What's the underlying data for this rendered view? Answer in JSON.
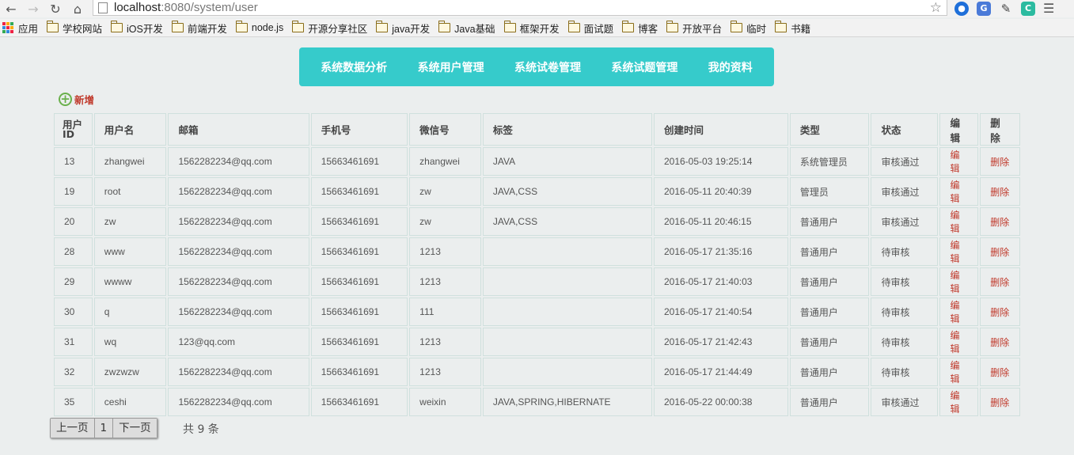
{
  "browser": {
    "url_host": "localhost",
    "url_path": ":8080/system/user",
    "bookmarks": [
      {
        "label": "应用",
        "icon": "apps-icon"
      },
      {
        "label": "学校网站",
        "icon": "folder-icon"
      },
      {
        "label": "iOS开发",
        "icon": "folder-icon"
      },
      {
        "label": "前端开发",
        "icon": "folder-icon"
      },
      {
        "label": "node.js",
        "icon": "folder-icon"
      },
      {
        "label": "开源分享社区",
        "icon": "folder-icon"
      },
      {
        "label": "java开发",
        "icon": "folder-icon"
      },
      {
        "label": "Java基础",
        "icon": "folder-icon"
      },
      {
        "label": "框架开发",
        "icon": "folder-icon"
      },
      {
        "label": "面试题",
        "icon": "folder-icon"
      },
      {
        "label": "博客",
        "icon": "folder-icon"
      },
      {
        "label": "开放平台",
        "icon": "folder-icon"
      },
      {
        "label": "临时",
        "icon": "folder-icon"
      },
      {
        "label": "书籍",
        "icon": "folder-icon"
      }
    ]
  },
  "nav": {
    "items": [
      "系统数据分析",
      "系统用户管理",
      "系统试卷管理",
      "系统试题管理",
      "我的资料"
    ],
    "color": "#36cbcb"
  },
  "add_label": "新增",
  "table": {
    "headers": [
      "用户ID",
      "用户名",
      "邮箱",
      "手机号",
      "微信号",
      "标签",
      "创建时间",
      "类型",
      "状态",
      "编辑",
      "删除"
    ],
    "rows": [
      [
        "13",
        "zhangwei",
        "1562282234@qq.com",
        "15663461691",
        "zhangwei",
        "JAVA",
        "2016-05-03 19:25:14",
        "系统管理员",
        "审核通过",
        "编辑",
        "删除"
      ],
      [
        "19",
        "root",
        "1562282234@qq.com",
        "15663461691",
        "zw",
        "JAVA,CSS",
        "2016-05-11 20:40:39",
        "管理员",
        "审核通过",
        "编辑",
        "删除"
      ],
      [
        "20",
        "zw",
        "1562282234@qq.com",
        "15663461691",
        "zw",
        "JAVA,CSS",
        "2016-05-11 20:46:15",
        "普通用户",
        "审核通过",
        "编辑",
        "删除"
      ],
      [
        "28",
        "www",
        "1562282234@qq.com",
        "15663461691",
        "1213",
        "",
        "2016-05-17 21:35:16",
        "普通用户",
        "待审核",
        "编辑",
        "删除"
      ],
      [
        "29",
        "wwww",
        "1562282234@qq.com",
        "15663461691",
        "1213",
        "",
        "2016-05-17 21:40:03",
        "普通用户",
        "待审核",
        "编辑",
        "删除"
      ],
      [
        "30",
        "q",
        "1562282234@qq.com",
        "15663461691",
        "111",
        "",
        "2016-05-17 21:40:54",
        "普通用户",
        "待审核",
        "编辑",
        "删除"
      ],
      [
        "31",
        "wq",
        "123@qq.com",
        "15663461691",
        "1213",
        "",
        "2016-05-17 21:42:43",
        "普通用户",
        "待审核",
        "编辑",
        "删除"
      ],
      [
        "32",
        "zwzwzw",
        "1562282234@qq.com",
        "15663461691",
        "1213",
        "",
        "2016-05-17 21:44:49",
        "普通用户",
        "待审核",
        "编辑",
        "删除"
      ],
      [
        "35",
        "ceshi",
        "1562282234@qq.com",
        "15663461691",
        "weixin",
        "JAVA,SPRING,HIBERNATE",
        "2016-05-22 00:00:38",
        "普通用户",
        "审核通过",
        "编辑",
        "删除"
      ]
    ]
  },
  "pager": {
    "prev": "上一页",
    "current": "1",
    "next": "下一页",
    "total": "共 9 条"
  }
}
